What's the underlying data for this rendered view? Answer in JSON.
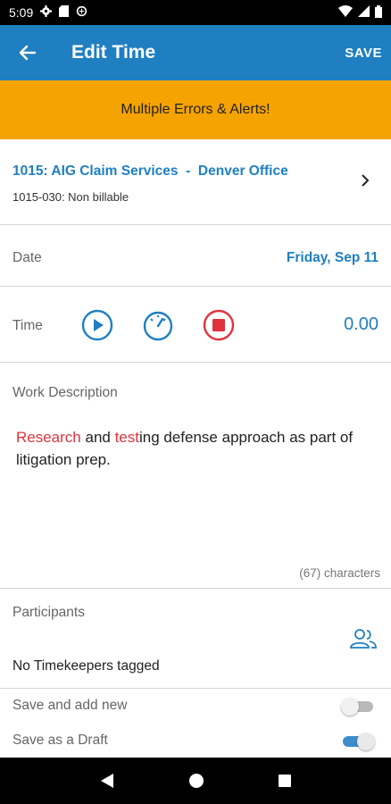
{
  "status_bar": {
    "time": "5:09"
  },
  "app_bar": {
    "title": "Edit Time",
    "save_label": "SAVE"
  },
  "alert": {
    "text": "Multiple Errors & Alerts!"
  },
  "matter": {
    "client": "1015: AIG Claim Services  -  Denver Office",
    "code": "1015-030: Non billable"
  },
  "date": {
    "label": "Date",
    "value": "Friday, Sep 11"
  },
  "time": {
    "label": "Time",
    "value": "0.00"
  },
  "work_description": {
    "label": "Work Description",
    "segments": [
      "Research",
      " and ",
      "test",
      "ing defense approach as part of litigation prep."
    ],
    "char_count": "(67) characters"
  },
  "participants": {
    "label": "Participants",
    "empty_text": "No Timekeepers tagged"
  },
  "options": [
    {
      "label": "Save and add new",
      "enabled": false
    },
    {
      "label": "Save as a Draft",
      "enabled": true
    }
  ],
  "colors": {
    "primary": "#1f7fc1",
    "alert": "#f5a300",
    "error": "#e0323c"
  }
}
